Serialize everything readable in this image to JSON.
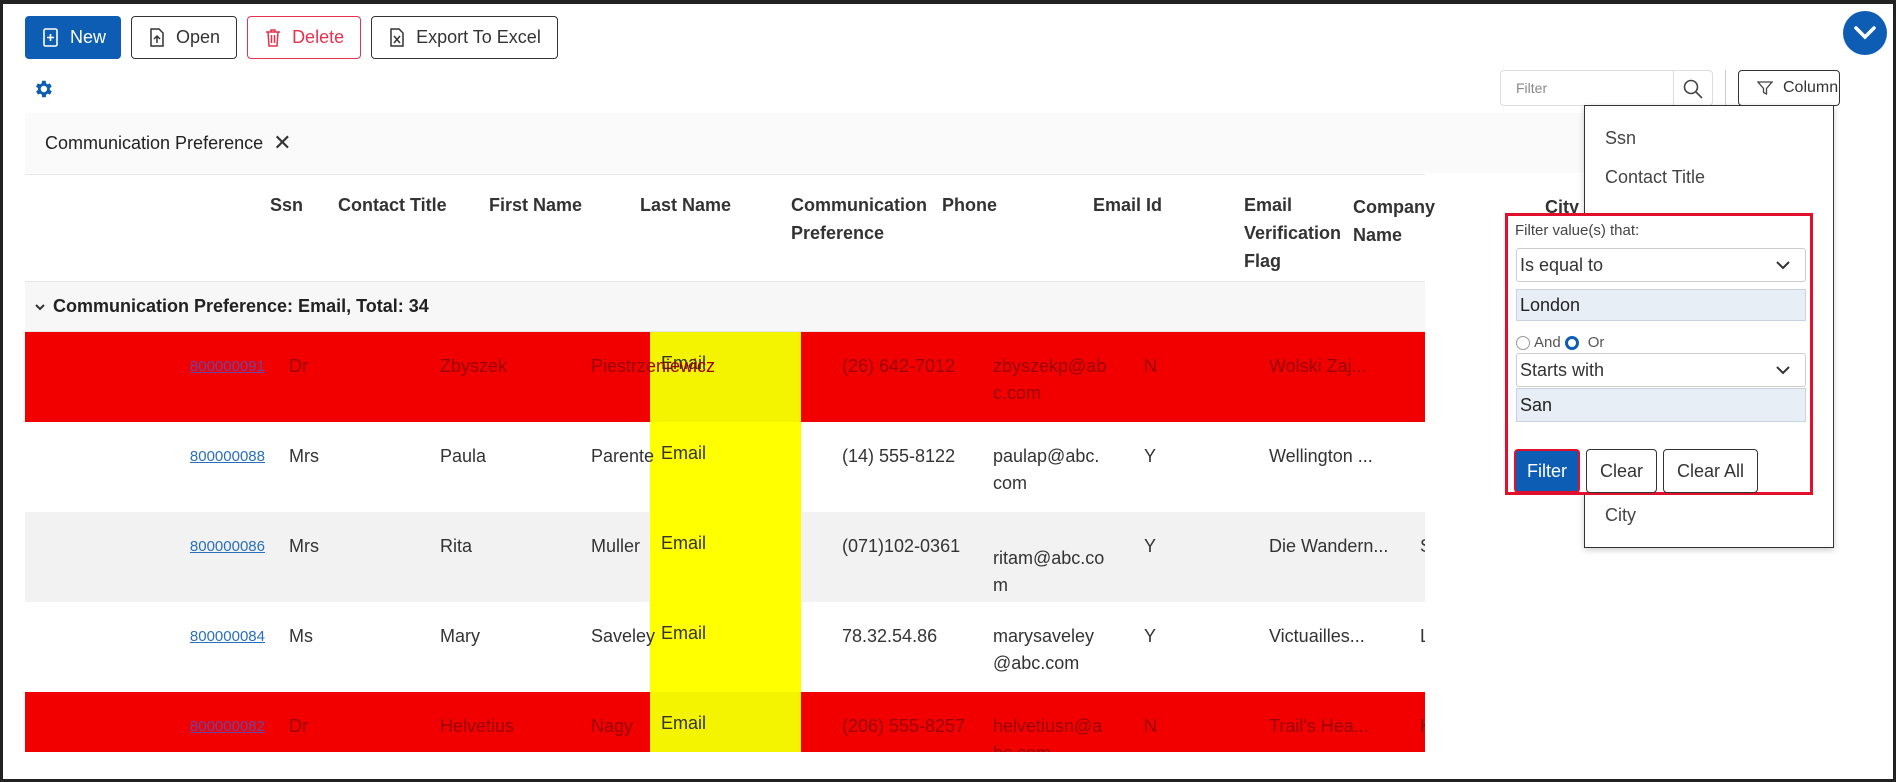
{
  "toolbar": {
    "new_label": "New",
    "open_label": "Open",
    "delete_label": "Delete",
    "export_label": "Export To Excel"
  },
  "search": {
    "placeholder": "Filter"
  },
  "column_button_label": "Column",
  "group_chip": {
    "label": "Communication Preference"
  },
  "columns": {
    "ssn": "Ssn",
    "contact_title": "Contact Title",
    "first_name": "First Name",
    "last_name": "Last Name",
    "comm_pref": "Communication Preference",
    "phone": "Phone",
    "email": "Email Id",
    "email_flag": "Email Verification Flag",
    "company": "Company Name",
    "city": "City"
  },
  "group_header": "Communication Preference: Email, Total: 34",
  "rows": [
    {
      "ssn": "800000091",
      "title": "Dr",
      "first": "Zbyszek",
      "last": "Piestrzeniewicz",
      "comm": "Email",
      "phone": "(26) 642-7012",
      "email": "zbyszekp@abc.com",
      "flag": "N",
      "company": "Wolski Zaj...",
      "city": "",
      "style": "red"
    },
    {
      "ssn": "800000088",
      "title": "Mrs",
      "first": "Paula",
      "last": "Parente",
      "comm": "Email",
      "phone": "(14) 555-8122",
      "email": "paulap@abc.com",
      "flag": "Y",
      "company": "Wellington ...",
      "city": "",
      "style": "white"
    },
    {
      "ssn": "800000086",
      "title": "Mrs",
      "first": "Rita",
      "last": "Muller",
      "comm": "Email",
      "phone": "(071)102-0361",
      "email": "ritam@abc.com",
      "flag": "Y",
      "company": "Die Wandern...",
      "city": "Stuttg",
      "style": "grey"
    },
    {
      "ssn": "800000084",
      "title": "Ms",
      "first": "Mary",
      "last": "Saveley",
      "comm": "Email",
      "phone": "78.32.54.86",
      "email": "marysaveley@abc.com",
      "flag": "Y",
      "company": "Victuailles...",
      "city": "Lyon",
      "style": "white"
    },
    {
      "ssn": "800000082",
      "title": "Dr",
      "first": "Helvetius",
      "last": "Nagy",
      "comm": "Email",
      "phone": "(206) 555-8257",
      "email": "helvetiusn@abc.com",
      "flag": "N",
      "company": "Trail's Hea...",
      "city": "Kirkland",
      "style": "red"
    }
  ],
  "column_menu": {
    "items": [
      "Ssn",
      "Contact Title",
      "City"
    ]
  },
  "filter_panel": {
    "label": "Filter value(s) that:",
    "operator1": "Is equal to",
    "value1": "London",
    "logic_and": "And",
    "logic_or": "Or",
    "operator2": "Starts with",
    "value2": "San",
    "filter_label": "Filter",
    "clear_label": "Clear",
    "clear_all_label": "Clear All"
  },
  "colors": {
    "accent": "#0d5db4",
    "danger": "#e6314f",
    "row_highlight": "#f20000",
    "comm_highlight": "#ffff00"
  }
}
